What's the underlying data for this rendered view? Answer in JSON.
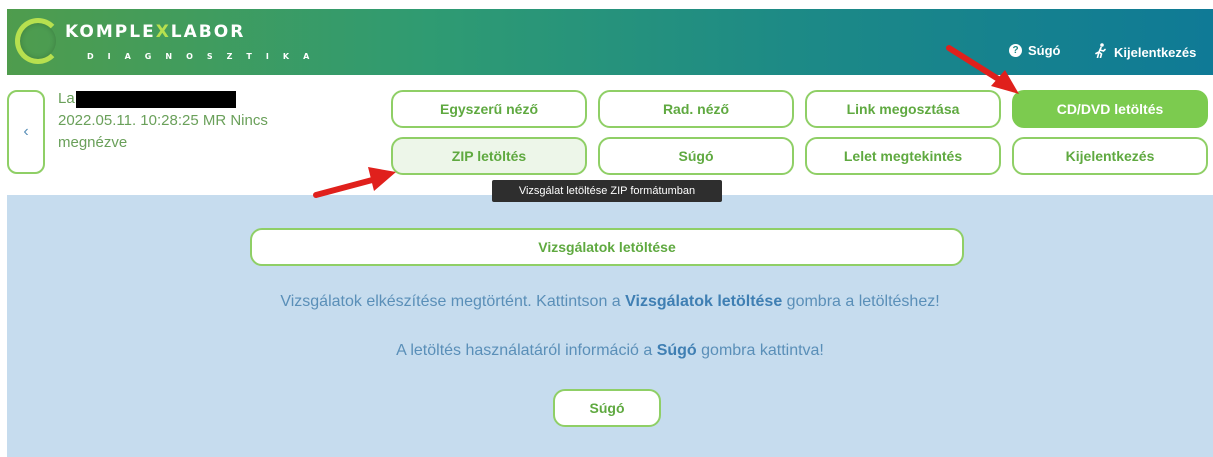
{
  "header": {
    "logo_main_pre": "KOMPLE",
    "logo_main_x": "X",
    "logo_main_post": "LABOR",
    "logo_sub": "DIAGNOSZTIKA",
    "help_label": "Súgó",
    "logout_label": "Kijelentkezés",
    "help_icon": "question-circle-icon",
    "logout_icon": "running-person-icon"
  },
  "study": {
    "name_prefix": "La",
    "line2": "2022.05.11. 10:28:25 MR Nincs",
    "line3": "megnézve"
  },
  "buttons": {
    "simple_viewer": "Egyszerű néző",
    "rad_viewer": "Rad. néző",
    "share_link": "Link megosztása",
    "cd_download": "CD/DVD letöltés",
    "zip_download": "ZIP letöltés",
    "help": "Súgó",
    "report_view": "Lelet megtekintés",
    "logout": "Kijelentkezés"
  },
  "tooltip": "Vizsgálat letöltése ZIP formátumban",
  "main": {
    "download_button": "Vizsgálatok letöltése",
    "msg1_pre": "Vizsgálatok elkészítése megtörtént. Kattintson a ",
    "msg1_bold": "Vizsgálatok letöltése",
    "msg1_post": " gombra a letöltéshez!",
    "msg2_pre": "A letöltés használatáról információ a ",
    "msg2_bold": "Súgó",
    "msg2_post": " gombra kattintva!",
    "help_button": "Súgó"
  },
  "colors": {
    "accent_green": "#7ccb4f",
    "panel_blue": "#c6dcee",
    "arrow_red": "#e0201c"
  }
}
